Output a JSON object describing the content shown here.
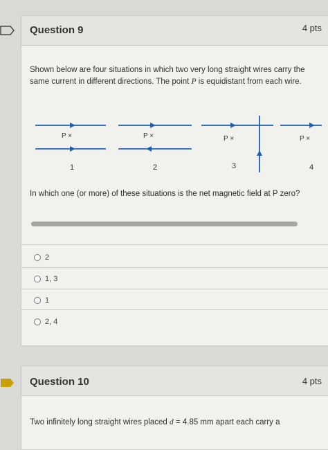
{
  "question9": {
    "title": "Question 9",
    "points": "4 pts",
    "stem_before": "Shown below are four situations in which two very long straight wires carry the same current in different directions. The point ",
    "stem_var": "P",
    "stem_after": " is equidistant from each wire.",
    "diagram": {
      "point_label": "P ×",
      "situation_labels": [
        "1",
        "2",
        "3",
        "4"
      ]
    },
    "prompt": "In which one (or more) of these situations is the net magnetic field at P zero?",
    "answers": [
      {
        "label": "2"
      },
      {
        "label": "1, 3"
      },
      {
        "label": "1"
      },
      {
        "label": "2, 4"
      }
    ]
  },
  "question10": {
    "title": "Question 10",
    "points": "4 pts",
    "stem_start": "Two infinitely long straight wires placed ",
    "stem_var": "d",
    "stem_eq": " = 4.85 mm apart each carry a"
  },
  "colors": {
    "accent_flag": "#c8a000",
    "wire_blue": "#1f5fb4"
  }
}
